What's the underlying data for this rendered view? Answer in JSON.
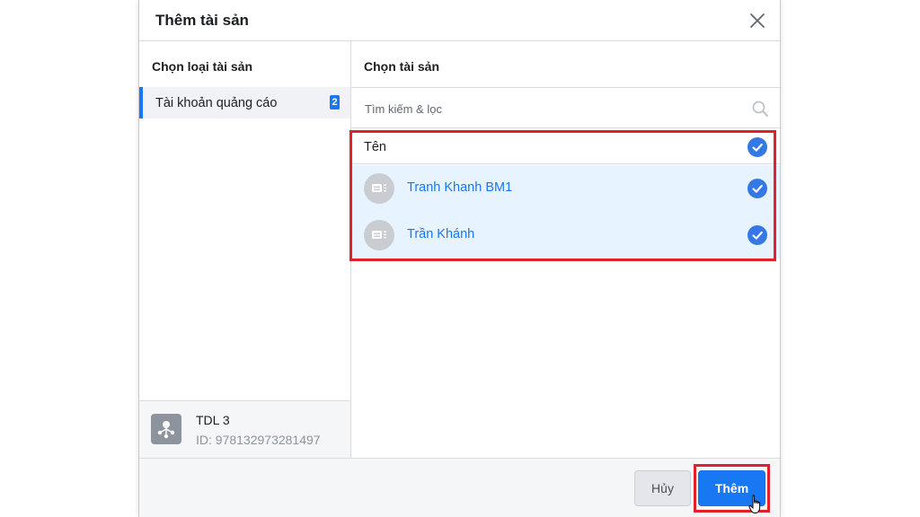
{
  "dialog": {
    "title": "Thêm tài sản",
    "close_icon": "close-icon"
  },
  "left_column": {
    "title": "Chọn loại tài sản",
    "items": [
      {
        "label": "Tài khoản quảng cáo",
        "count": "2",
        "selected": true
      }
    ],
    "business": {
      "name": "TDL 3",
      "id_text": "ID: 978132973281497",
      "icon": "business-icon"
    }
  },
  "right_column": {
    "title": "Chọn tài sản",
    "search": {
      "placeholder": "Tìm kiếm & lọc",
      "value": "",
      "icon": "search-icon"
    },
    "header": {
      "label": "Tên",
      "checked": true
    },
    "assets": [
      {
        "name": "Tranh Khanh BM1",
        "checked": true,
        "icon": "ad-account-icon"
      },
      {
        "name": "Trần Khánh",
        "checked": true,
        "icon": "ad-account-icon"
      }
    ]
  },
  "footer": {
    "cancel_label": "Hủy",
    "add_label": "Thêm"
  },
  "colors": {
    "accent": "#1877f2",
    "check": "#3578e5",
    "selected_row": "#e7f3ff",
    "highlight": "#e0212b"
  }
}
